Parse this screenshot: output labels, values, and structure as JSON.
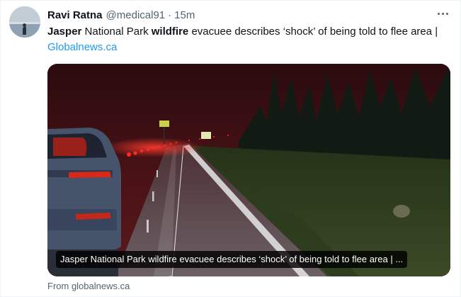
{
  "tweet": {
    "author_name": "Ravi Ratna",
    "author_handle": "@medical91",
    "separator": "·",
    "time": "15m",
    "text_segments": {
      "s1": "Jasper",
      "s2": " National Park ",
      "s3": "wildfire",
      "s4": " evacuee describes ‘shock’ of being told to flee area  | ",
      "link": "Globalnews.ca"
    },
    "more_icon": "more-horizontal-icon"
  },
  "card": {
    "caption": "Jasper National Park wildfire evacuee describes ‘shock’ of being told to flee area | ...",
    "source": "From globalnews.ca"
  },
  "colors": {
    "text": "#0f1419",
    "secondary": "#536471",
    "link": "#1d9bf0"
  }
}
